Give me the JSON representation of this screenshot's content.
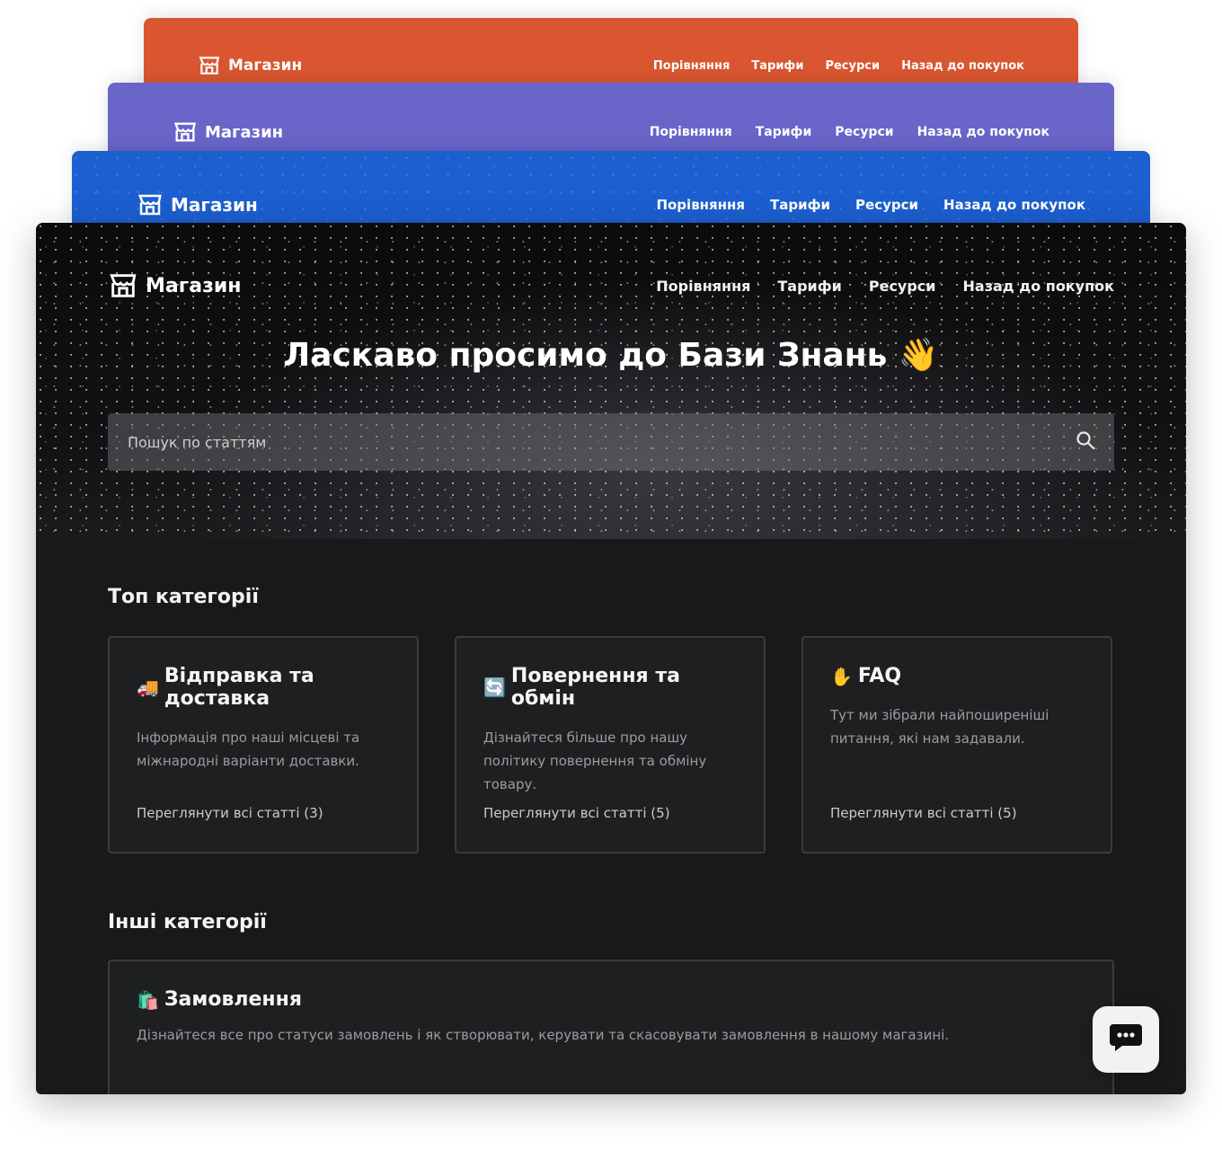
{
  "brand": {
    "name": "Магазин",
    "icon": "store-icon"
  },
  "nav": {
    "items": [
      "Порівняння",
      "Тарифи",
      "Ресурси",
      "Назад до покупок"
    ]
  },
  "theme_colors": {
    "orange": "#da5630",
    "purple": "#6a65c9",
    "blue": "#1c5fd0",
    "dark": "#18191b"
  },
  "hero": {
    "title": "Ласкаво просимо до Бази Знань",
    "title_emoji": "👋"
  },
  "search": {
    "placeholder": "Пошук по статтям",
    "icon": "search-icon"
  },
  "top_categories": {
    "title": "Топ категорії",
    "cards": [
      {
        "emoji": "🚚",
        "title": "Відправка та доставка",
        "description": "Інформація про наші місцеві та міжнародні варіанти доставки.",
        "link": "Переглянути всі статті (3)"
      },
      {
        "emoji": "🔄",
        "title": "Повернення та обмін",
        "description": "Дізнайтеся більше про нашу політику повернення та обміну товару.",
        "link": "Переглянути всі статті  (5)"
      },
      {
        "emoji": "✋",
        "title": "FAQ",
        "description": "Тут ми зібрали найпоширеніші питання, які нам задавали.",
        "link": "Переглянути всі статті  (5)"
      }
    ]
  },
  "other_categories": {
    "title": "Інші категорії",
    "cards": [
      {
        "emoji": "🛍️",
        "title": "Замовлення",
        "description": "Дізнайтеся все про статуси замовлень і як створювати, керувати та скасовувати замовлення в нашому магазині."
      }
    ]
  },
  "chat": {
    "icon": "chat-icon"
  }
}
